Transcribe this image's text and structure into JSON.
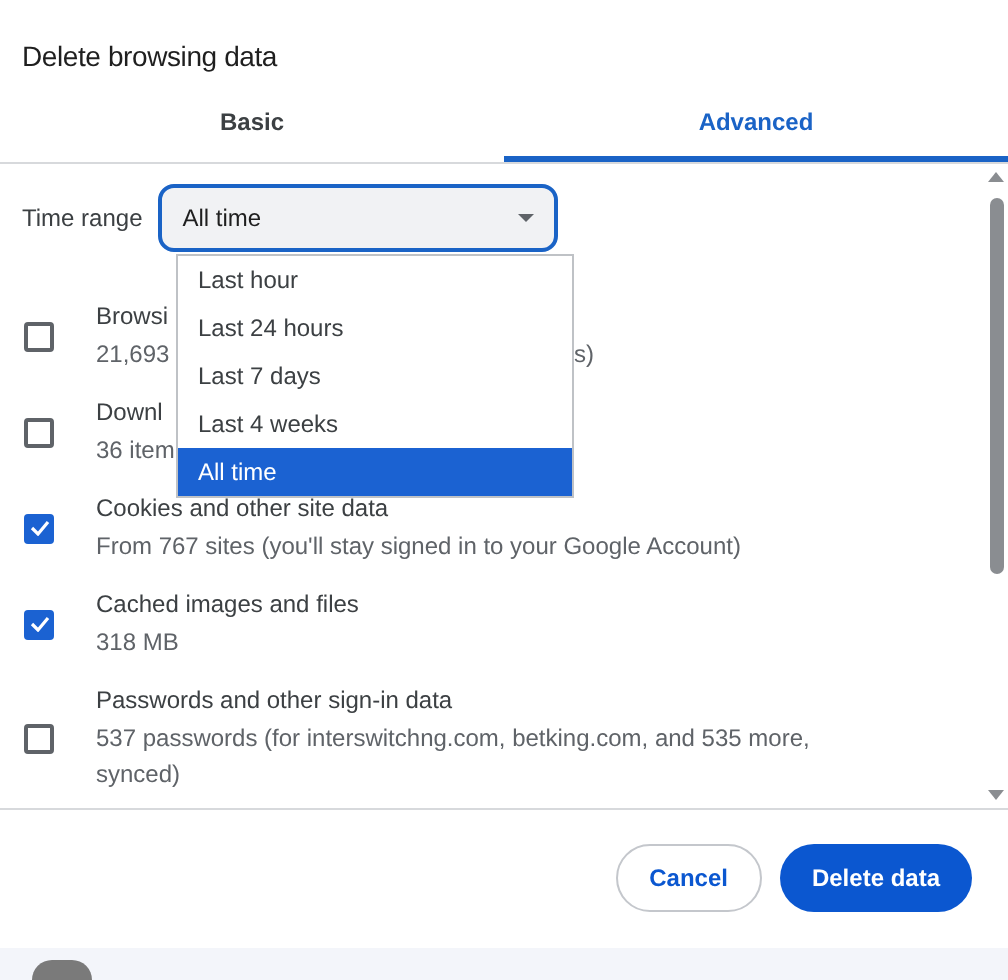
{
  "dialog": {
    "title": "Delete browsing data"
  },
  "tabs": [
    {
      "label": "Basic",
      "selected": false
    },
    {
      "label": "Advanced",
      "selected": true
    }
  ],
  "time_range": {
    "label": "Time range",
    "value": "All time",
    "options": [
      {
        "label": "Last hour",
        "selected": false
      },
      {
        "label": "Last 24 hours",
        "selected": false
      },
      {
        "label": "Last 7 days",
        "selected": false
      },
      {
        "label": "Last 4 weeks",
        "selected": false
      },
      {
        "label": "All time",
        "selected": true
      }
    ]
  },
  "items": [
    {
      "title": "Browsi",
      "subtitle": "21,693",
      "subtitle_tail": "s)",
      "checked": false
    },
    {
      "title": "Downl",
      "subtitle": "36 item",
      "checked": false
    },
    {
      "title": "Cookies and other site data",
      "subtitle": "From 767 sites (you'll stay signed in to your Google Account)",
      "checked": true
    },
    {
      "title": "Cached images and files",
      "subtitle": "318 MB",
      "checked": true
    },
    {
      "title": "Passwords and other sign-in data",
      "subtitle": "537 passwords (for interswitchng.com, betking.com, and 535 more, synced)",
      "checked": false
    }
  ],
  "buttons": [
    {
      "label": "Cancel",
      "kind": "secondary"
    },
    {
      "label": "Delete data",
      "kind": "primary"
    }
  ]
}
